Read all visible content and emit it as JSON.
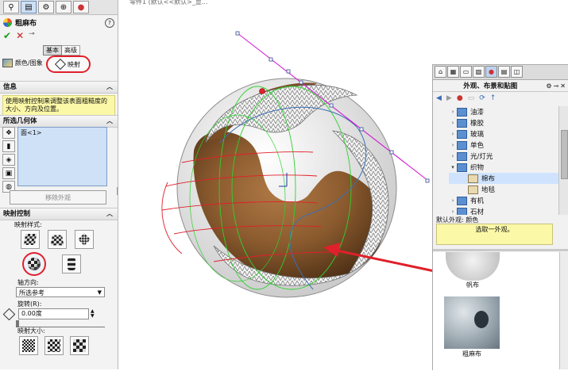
{
  "window": {
    "title_fragment": "零件1 (默认<<默认>_显..."
  },
  "pm": {
    "title": "粗麻布",
    "help": "?",
    "tab_basic": "基本",
    "tab_advanced": "高级",
    "tab_color": "颜色/图象",
    "tab_mapping": "映射",
    "info_head": "信息",
    "info_text": "使用映射控制来调整该表面粗糙度的大小、方向及位置。",
    "geo_head": "所选几何体",
    "geo_item": "面<1>",
    "remove_btn": "移除外观",
    "map_head": "映射控制",
    "map_style": "映射样式:",
    "axis_label": "轴方向:",
    "axis_value": "所选参考",
    "rot_label": "旋转(R):",
    "rot_value": "0.00度",
    "size_label": "映射大小:"
  },
  "taskpane": {
    "title": "外观、布景和贴图",
    "tree": [
      {
        "label": "油漆",
        "expanded": false,
        "selected": false
      },
      {
        "label": "橡胶",
        "expanded": false,
        "selected": false
      },
      {
        "label": "玻璃",
        "expanded": false,
        "selected": false
      },
      {
        "label": "单色",
        "expanded": false,
        "selected": false
      },
      {
        "label": "光/灯光",
        "expanded": false,
        "selected": false
      },
      {
        "label": "织物",
        "expanded": true,
        "selected": false
      },
      {
        "label": "棉布",
        "expanded": false,
        "selected": true
      },
      {
        "label": "地毯",
        "expanded": false,
        "selected": false
      },
      {
        "label": "有机",
        "expanded": false,
        "selected": false
      },
      {
        "label": "石材",
        "expanded": false,
        "selected": false
      }
    ],
    "default_label": "默认外观: 颜色",
    "hint": "选取一外观。",
    "swatches": [
      {
        "label": "帆布"
      },
      {
        "label": "粗麻布"
      }
    ]
  },
  "colors": {
    "annotation_red": "#e0202a",
    "accent_blue": "#3a6fb5",
    "hint_yellow": "#fbf8a8",
    "ball_brown": "#8a5a2e"
  },
  "icons": [
    "feature-manager-icon",
    "property-manager-icon",
    "config-manager-icon",
    "dimxpert-icon",
    "display-manager-icon",
    "ok-check-icon",
    "cancel-x-icon",
    "pin-icon",
    "help-icon",
    "mapping-style-icon",
    "sphere-mapping-icon",
    "cylindrical-mapping-icon",
    "reference-icon",
    "rotate-icon"
  ]
}
